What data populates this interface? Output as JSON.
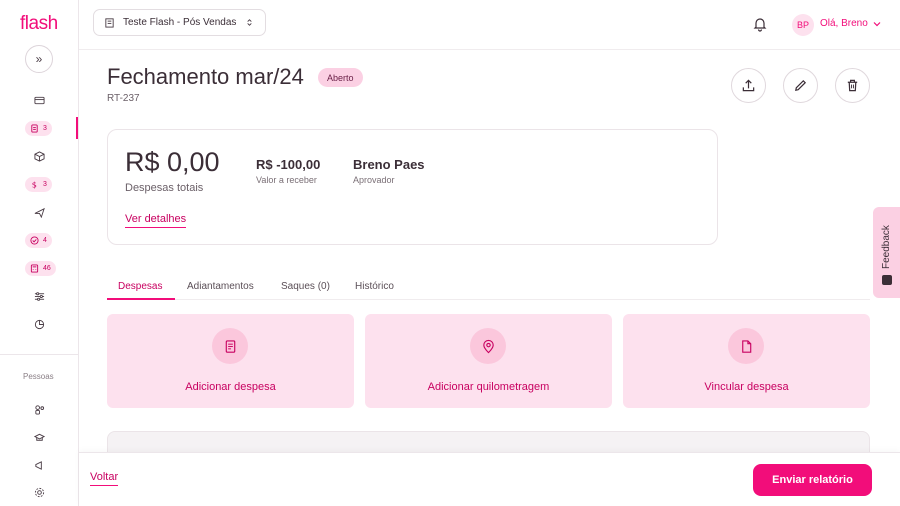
{
  "brand": {
    "logo": "flash",
    "accent": "#f20d7a"
  },
  "sidebar": {
    "expand_icon": "»",
    "items": [
      {
        "icon": "wallet-icon",
        "badge": ""
      },
      {
        "icon": "receipt-icon",
        "badge": "3"
      },
      {
        "icon": "box-icon",
        "badge": ""
      },
      {
        "icon": "dollar-icon",
        "badge": "3"
      },
      {
        "icon": "plane-icon",
        "badge": ""
      },
      {
        "icon": "check-circle-icon",
        "badge": "4"
      },
      {
        "icon": "calculator-icon",
        "badge": "46"
      },
      {
        "icon": "sliders-icon",
        "badge": ""
      },
      {
        "icon": "pie-chart-icon",
        "badge": ""
      }
    ],
    "section_label": "Pessoas",
    "people_items": [
      {
        "icon": "people-icon"
      },
      {
        "icon": "graduation-icon"
      },
      {
        "icon": "megaphone-icon"
      },
      {
        "icon": "gear-icon"
      }
    ]
  },
  "topbar": {
    "company": "Teste Flash - Pós Vendas",
    "avatar_initials": "BP",
    "greeting": "Olá, Breno"
  },
  "report": {
    "title": "Fechamento mar/24",
    "status": "Aberto",
    "code": "RT-237"
  },
  "summary": {
    "total_value": "R$ 0,00",
    "total_label": "Despesas totais",
    "receivable_value": "R$ -100,00",
    "receivable_label": "Valor a receber",
    "approver_value": "Breno Paes",
    "approver_label": "Aprovador",
    "details_link": "Ver detalhes"
  },
  "tabs": [
    "Despesas",
    "Adiantamentos",
    "Saques (0)",
    "Histórico"
  ],
  "cards": [
    {
      "icon": "receipt-icon",
      "label": "Adicionar despesa"
    },
    {
      "icon": "map-pin-icon",
      "label": "Adicionar quilometragem"
    },
    {
      "icon": "document-icon",
      "label": "Vincular despesa"
    }
  ],
  "footer": {
    "back_label": "Voltar",
    "submit_label": "Enviar relatório"
  },
  "feedback": {
    "label": "Feedback"
  }
}
